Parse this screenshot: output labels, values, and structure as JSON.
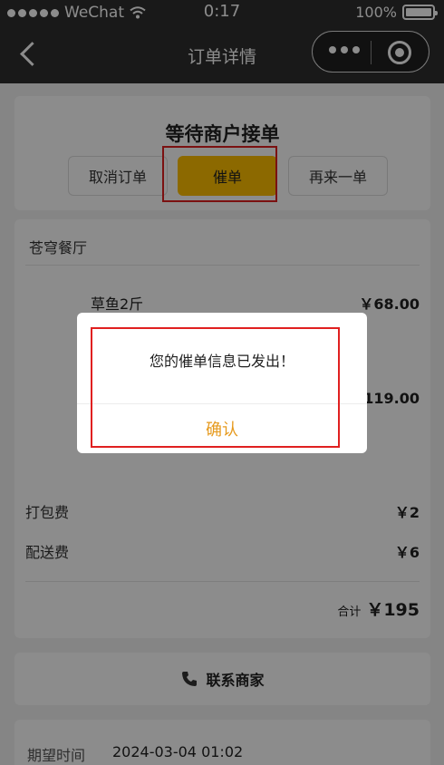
{
  "status_bar": {
    "carrier": "WeChat",
    "time": "0:17",
    "battery": "100%"
  },
  "nav": {
    "title": "订单详情"
  },
  "order_status": {
    "title": "等待商户接单",
    "buttons": {
      "cancel": "取消订单",
      "urge": "催单",
      "again": "再来一单"
    }
  },
  "shop": {
    "name": "苍穹餐厅"
  },
  "items": [
    {
      "name": "草鱼2斤",
      "price": "￥68.00"
    },
    {
      "name": "",
      "price": "119.00"
    }
  ],
  "fees": {
    "packing_label": "打包费",
    "packing_value": "￥2",
    "delivery_label": "配送费",
    "delivery_value": "￥6"
  },
  "total": {
    "label": "合计",
    "value": "￥195"
  },
  "contact": {
    "label": "联系商家"
  },
  "expected_time": {
    "label": "期望时间",
    "value": "2024-03-04 01:02"
  },
  "modal": {
    "message": "您的催单信息已发出！",
    "confirm": "确认"
  },
  "colors": {
    "accent": "#ffbf00",
    "confirm_text": "#e69a1e",
    "highlight": "#e02020"
  }
}
